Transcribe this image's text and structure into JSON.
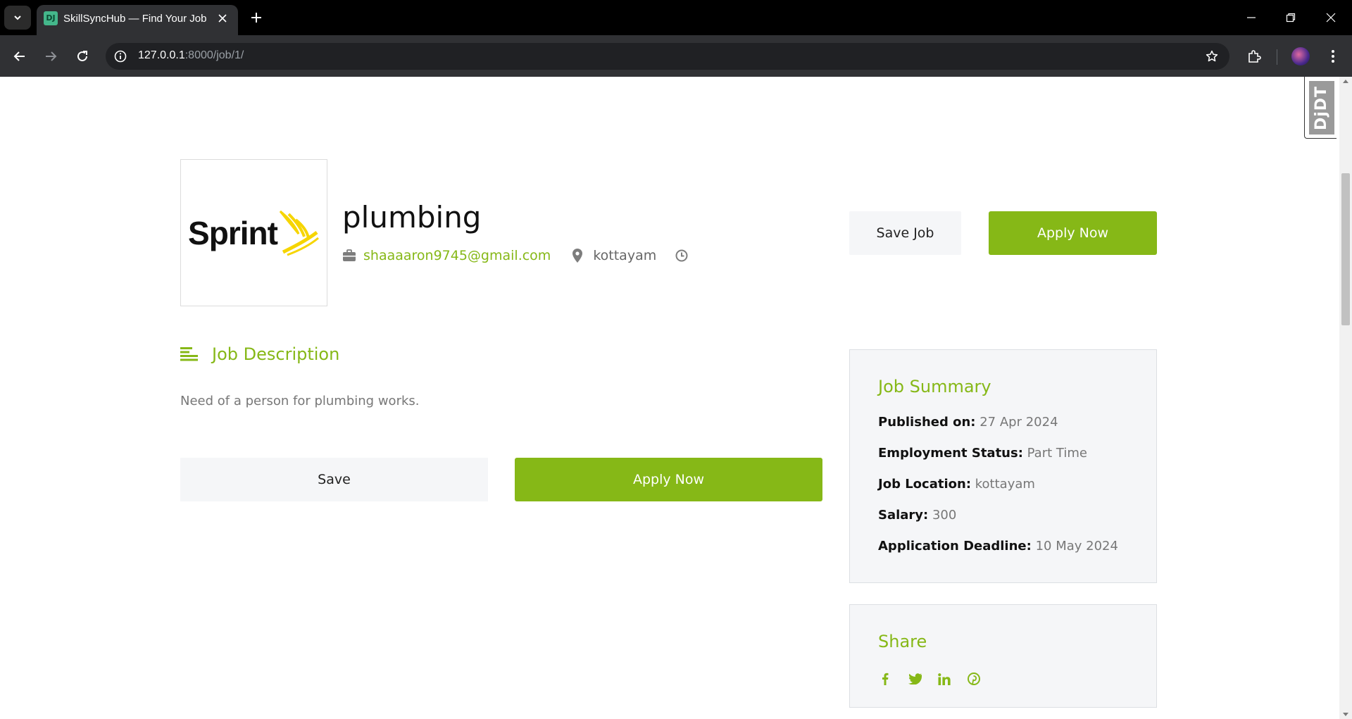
{
  "browser": {
    "tab_title": "SkillSyncHub — Find Your Job",
    "tab_favicon_text": "DJ",
    "url_host": "127.0.0.1",
    "url_rest": ":8000/job/1/"
  },
  "debug_toolbar": {
    "label": "DjDT"
  },
  "job": {
    "company_logo_text": "Sprint",
    "title": "plumbing",
    "email": "shaaaaron9745@gmail.com",
    "location": "kottayam",
    "save_job_label": "Save Job",
    "apply_label": "Apply Now"
  },
  "description": {
    "heading": "Job Description",
    "text": "Need of a person for plumbing works.",
    "save_label": "Save",
    "apply_label": "Apply Now"
  },
  "summary": {
    "heading": "Job Summary",
    "rows": [
      {
        "label": "Published on:",
        "value": "27 Apr 2024"
      },
      {
        "label": "Employment Status:",
        "value": "Part Time"
      },
      {
        "label": "Job Location:",
        "value": "kottayam"
      },
      {
        "label": "Salary:",
        "value": "300"
      },
      {
        "label": "Application Deadline:",
        "value": "10 May 2024"
      }
    ]
  },
  "share": {
    "heading": "Share",
    "icons": [
      "facebook-icon",
      "twitter-icon",
      "linkedin-icon",
      "pinterest-icon"
    ]
  },
  "colors": {
    "accent": "#86b817",
    "muted_text": "#777777",
    "card_bg": "#f5f6f8"
  }
}
